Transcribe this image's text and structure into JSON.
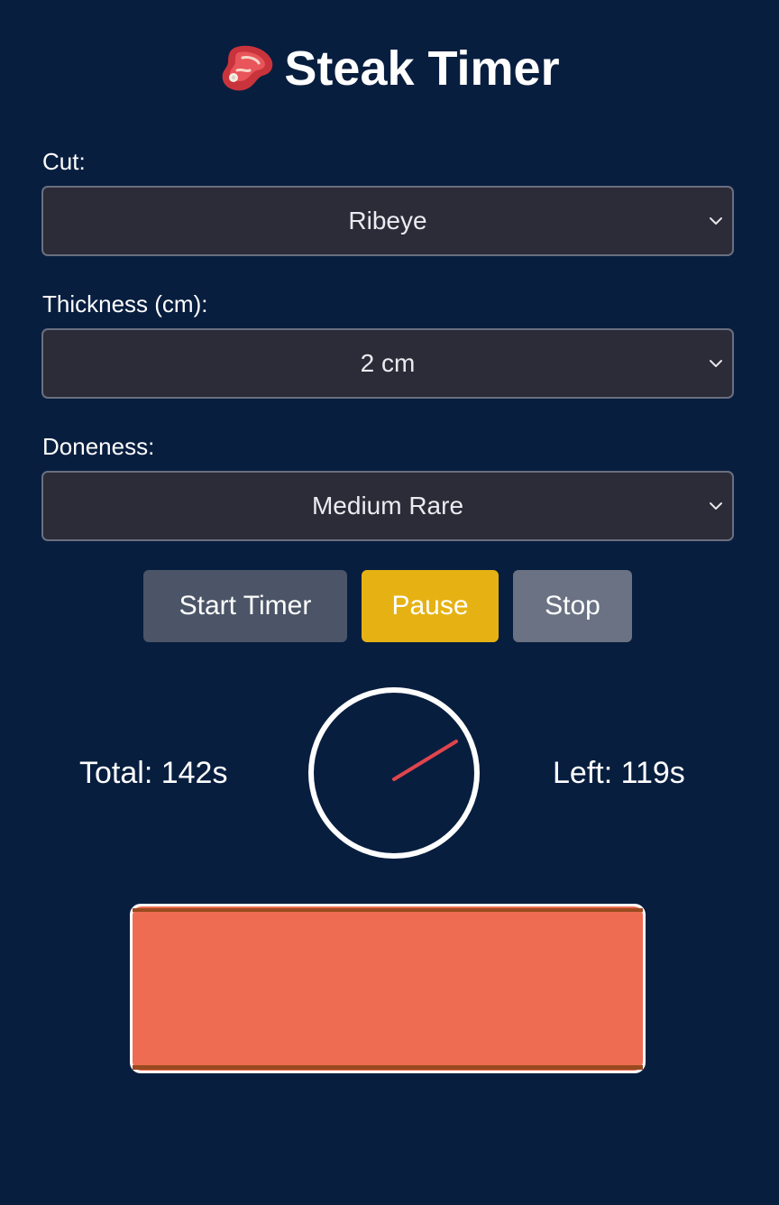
{
  "app": {
    "title": "Steak Timer",
    "icon": "steak-icon"
  },
  "form": {
    "cut": {
      "label": "Cut:",
      "value": "Ribeye"
    },
    "thickness": {
      "label": "Thickness (cm):",
      "value": "2 cm"
    },
    "doneness": {
      "label": "Doneness:",
      "value": "Medium Rare"
    }
  },
  "controls": {
    "start_label": "Start Timer",
    "pause_label": "Pause",
    "stop_label": "Stop"
  },
  "timer": {
    "total_text": "Total: 142s",
    "left_text": "Left: 119s",
    "total_seconds": 142,
    "left_seconds": 119
  },
  "colors": {
    "background": "#081e3f",
    "pause": "#e6b213",
    "hand": "#e0454d",
    "steak_flesh": "#ee6d52",
    "steak_sear": "#9a4a20"
  }
}
